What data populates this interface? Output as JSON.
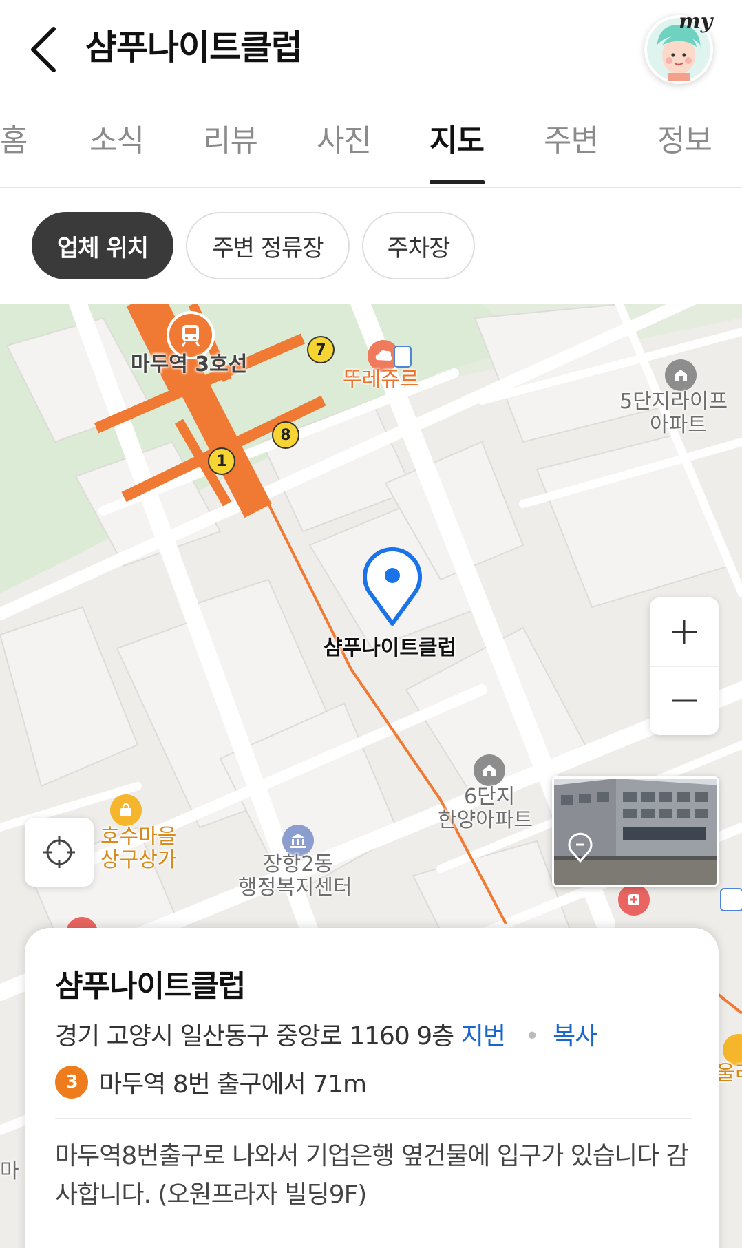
{
  "header": {
    "title": "샴푸나이트클럽",
    "my_badge": "my"
  },
  "tabs": [
    {
      "label": "홈"
    },
    {
      "label": "소식"
    },
    {
      "label": "리뷰"
    },
    {
      "label": "사진"
    },
    {
      "label": "지도",
      "active": true
    },
    {
      "label": "주변"
    },
    {
      "label": "정보"
    }
  ],
  "chips": [
    {
      "label": "업체 위치",
      "active": true
    },
    {
      "label": "주변 정류장"
    },
    {
      "label": "주차장"
    }
  ],
  "map": {
    "labels": {
      "station": "마두역 3호선",
      "cafe": "뚜레쥬르",
      "apt5_line1": "5단지라이프",
      "apt5_line2": "아파트",
      "business": "샴푸나이트클럽",
      "apt6_line1": "6단지",
      "apt6_line2": "한양아파트",
      "mall_line1": "호수마을",
      "mall_line2": "상구상가",
      "center_line1": "장항2동",
      "center_line2": "행정복지센터",
      "edge_right": "울리",
      "edge_left": "마"
    },
    "exits": [
      "1",
      "7",
      "8"
    ],
    "zoom_in": "+",
    "zoom_out": "−",
    "colors": {
      "subway_line": "#f07a34",
      "marker": "#1a73e8",
      "park": "#d9ead3",
      "road": "#ffffff"
    }
  },
  "card": {
    "title": "샴푸나이트클럽",
    "address": "경기 고양시 일산동구 중앙로 1160 9층",
    "jibun_link": "지번",
    "copy_link": "복사",
    "line_number": "3",
    "subway_text": "마두역 8번 출구에서 71m",
    "description": "마두역8번출구로 나와서 기업은행 옆건물에 입구가 있습니다 감사합니다. (오원프라자 빌딩9F)"
  }
}
